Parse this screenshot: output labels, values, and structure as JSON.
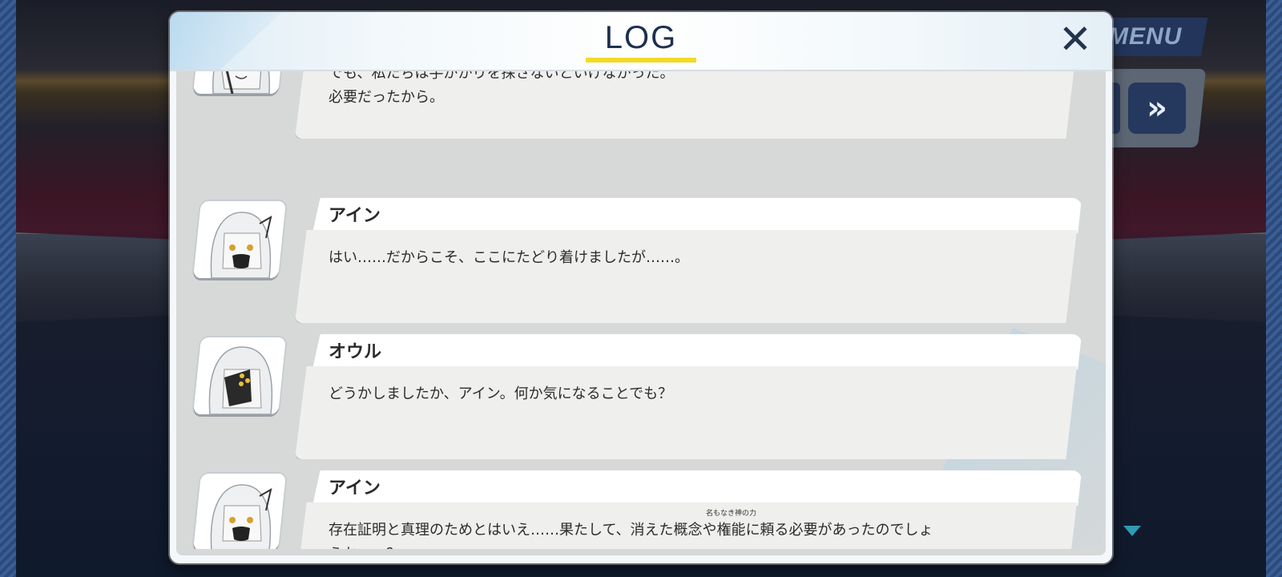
{
  "background": {
    "menu_label": "MENU",
    "skip_glyph": "»"
  },
  "dialog": {
    "title": "LOG",
    "close_glyph": "✕",
    "accent_color": "#f2d92a",
    "entries": [
      {
        "speaker": "",
        "portrait": "owl-character-portrait",
        "lines": [
          "でも、私たちは手がかりを探さないといけなかった。",
          "必要だったから。"
        ]
      },
      {
        "speaker": "アイン",
        "portrait": "ein-character-portrait",
        "lines": [
          "はい……だからこそ、ここにたどり着けましたが……。"
        ]
      },
      {
        "speaker": "オウル",
        "portrait": "owl-character-portrait",
        "lines": [
          "どうかしましたか、アイン。何か気になることでも？"
        ]
      },
      {
        "speaker": "アイン",
        "portrait": "ein-character-portrait",
        "line1_before": "存在証明と真理のためとはいえ……果たして、消えた概念や",
        "line1_ruby_base": "権能",
        "line1_ruby_text": "名もなき神の力",
        "line1_after": "に頼る必要があったのでしょ",
        "line2": "うか……？"
      }
    ]
  }
}
